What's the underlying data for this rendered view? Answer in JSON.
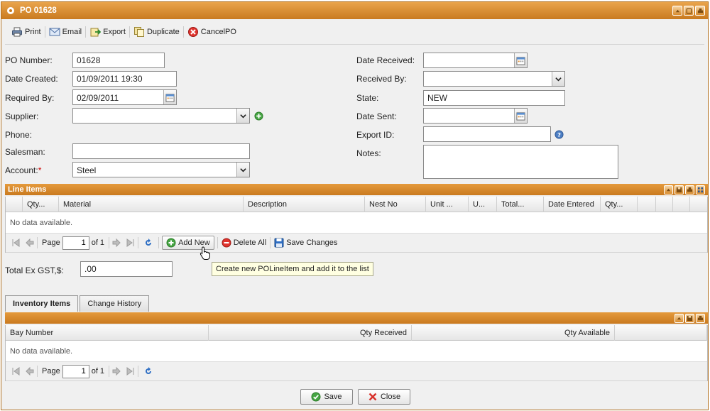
{
  "window": {
    "title": "PO 01628"
  },
  "toolbar": {
    "print": "Print",
    "email": "Email",
    "export": "Export",
    "duplicate": "Duplicate",
    "cancel_po": "CancelPO"
  },
  "form": {
    "po_number_label": "PO Number:",
    "po_number": "01628",
    "date_created_label": "Date Created:",
    "date_created": "01/09/2011 19:30",
    "required_by_label": "Required By:",
    "required_by": "02/09/2011",
    "supplier_label": "Supplier:",
    "supplier": "",
    "phone_label": "Phone:",
    "salesman_label": "Salesman:",
    "salesman": "",
    "account_label": "Account:",
    "account_required_mark": "*",
    "account": "Steel",
    "date_received_label": "Date Received:",
    "date_received": "",
    "received_by_label": "Received By:",
    "received_by": "",
    "state_label": "State:",
    "state": "NEW",
    "date_sent_label": "Date Sent:",
    "date_sent": "",
    "export_id_label": "Export ID:",
    "export_id": "",
    "notes_label": "Notes:",
    "notes": ""
  },
  "line_items": {
    "title": "Line Items",
    "columns": [
      "Qty...",
      "Material",
      "Description",
      "Nest No",
      "Unit ...",
      "U...",
      "Total...",
      "Date Entered",
      "Qty..."
    ],
    "empty_text": "No data available.",
    "pager": {
      "page_label": "Page",
      "page": "1",
      "of_label": "of 1"
    },
    "add_new": "Add New",
    "delete_all": "Delete All",
    "save_changes": "Save Changes",
    "tooltip": "Create new POLineItem and add it to the list"
  },
  "totals": {
    "label": "Total Ex GST,$:",
    "value": ".00"
  },
  "tabs": [
    "Inventory Items",
    "Change History"
  ],
  "inventory": {
    "columns": [
      "Bay Number",
      "Qty Received",
      "Qty Available"
    ],
    "empty_text": "No data available.",
    "pager": {
      "page_label": "Page",
      "page": "1",
      "of_label": "of 1"
    }
  },
  "footer": {
    "save": "Save",
    "close": "Close"
  }
}
